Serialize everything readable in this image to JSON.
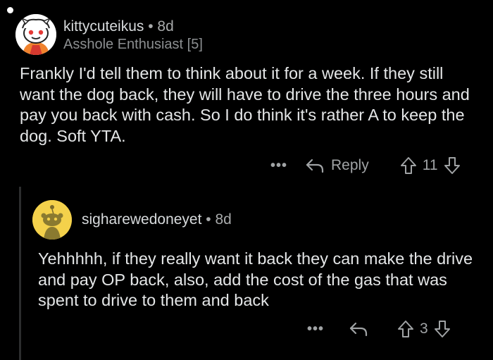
{
  "comment": {
    "username": "kittycuteikus",
    "separator": "•",
    "age": "8d",
    "flair": "Asshole Enthusiast [5]",
    "body": "Frankly I'd tell them to think about it for a week. If they still want the dog back, they will have to drive the three hours and pay you back with cash. So I do think it's rather A to keep the dog. Soft YTA.",
    "more_label": "•••",
    "reply_label": "Reply",
    "votes": "11"
  },
  "reply_comment": {
    "username": "sigharewedoneyet",
    "separator": "•",
    "age": "8d",
    "body": "Yehhhhh, if they really want it back they can make the drive and pay OP back, also, add the cost of the gas that was spent to drive to them and back",
    "more_label": "•••",
    "votes": "3"
  },
  "icons": {
    "avatar1": "snoo-avatar-icon",
    "avatar2": "snoo-avatar-icon",
    "reply": "reply-arrow-icon",
    "upvote": "upvote-arrow-icon",
    "downvote": "downvote-arrow-icon"
  },
  "colors": {
    "background": "#000000",
    "text": "#e4e6e7",
    "muted": "#a0a3a5",
    "avatar2_bg": "#f4d14b"
  }
}
